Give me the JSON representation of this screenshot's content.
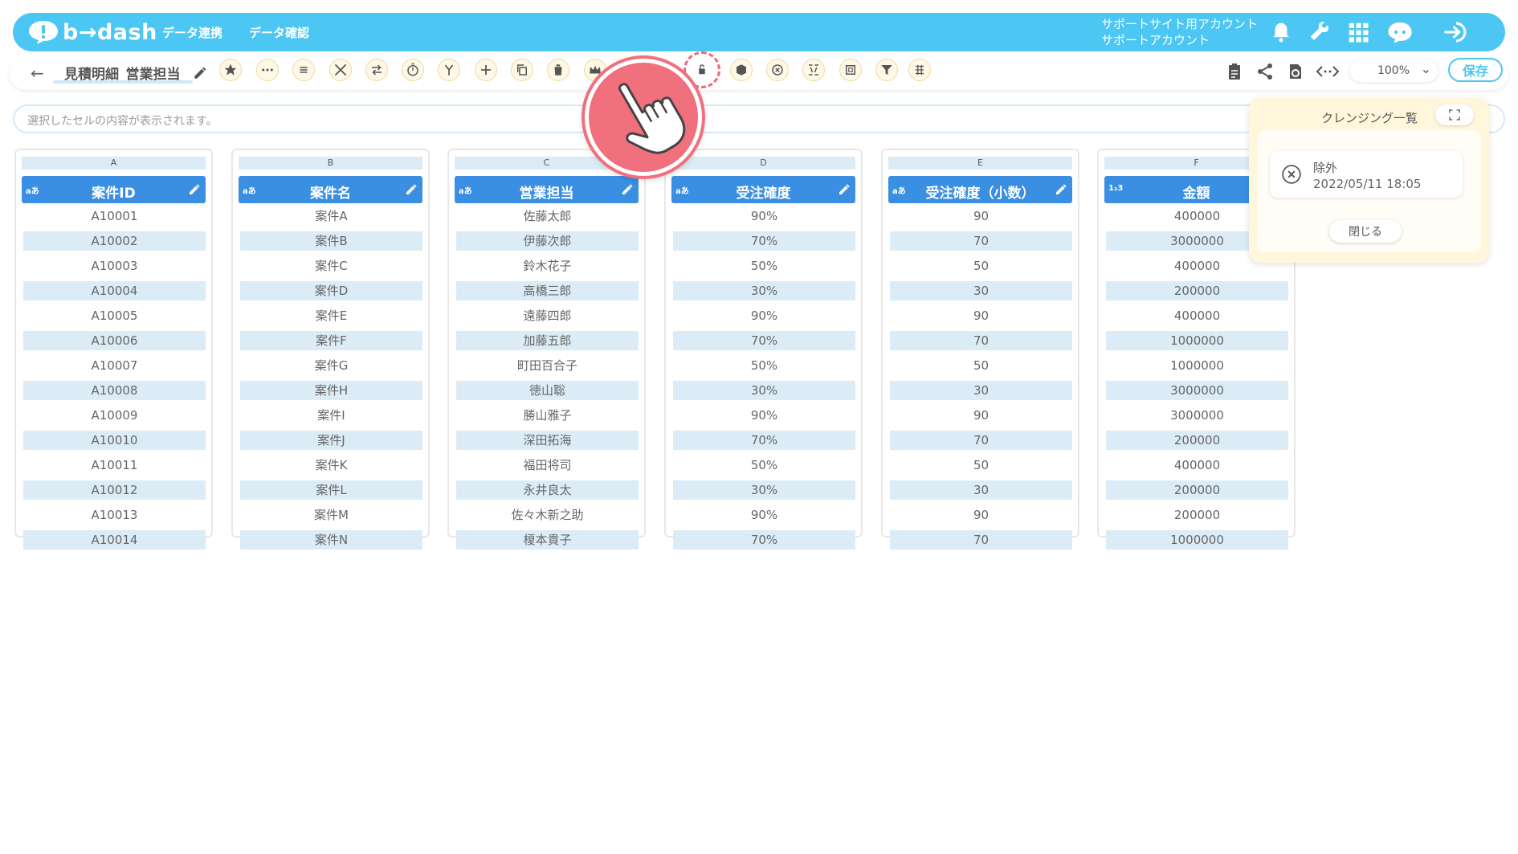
{
  "header": {
    "logo_text": "b→dash",
    "nav": [
      "データ連携",
      "データ確認"
    ],
    "account_line1": "サポートサイト用アカウント",
    "account_line2": "サポートアカウント",
    "icons": [
      "bell-icon",
      "wrench-icon",
      "grid-icon",
      "chat-bot-icon",
      "logout-icon"
    ]
  },
  "toolbar": {
    "back_icon": "←",
    "recipe_name": "見積明細_営業担当",
    "zoom": "100%",
    "save_label": "保存"
  },
  "cellbar": {
    "placeholder": "選択したセルの内容が表示されます。"
  },
  "columns": [
    {
      "letter": "A",
      "type": "aあ",
      "title": "案件ID",
      "values": [
        "A10001",
        "A10002",
        "A10003",
        "A10004",
        "A10005",
        "A10006",
        "A10007",
        "A10008",
        "A10009",
        "A10010",
        "A10011",
        "A10012",
        "A10013",
        "A10014"
      ]
    },
    {
      "letter": "B",
      "type": "aあ",
      "title": "案件名",
      "values": [
        "案件A",
        "案件B",
        "案件C",
        "案件D",
        "案件E",
        "案件F",
        "案件G",
        "案件H",
        "案件I",
        "案件J",
        "案件K",
        "案件L",
        "案件M",
        "案件N"
      ]
    },
    {
      "letter": "C",
      "type": "aあ",
      "title": "営業担当",
      "values": [
        "佐藤太郎",
        "伊藤次郎",
        "鈴木花子",
        "高橋三郎",
        "遠藤四郎",
        "加藤五郎",
        "町田百合子",
        "徳山聡",
        "勝山雅子",
        "深田拓海",
        "福田将司",
        "永井良太",
        "佐々木新之助",
        "榎本貴子"
      ]
    },
    {
      "letter": "D",
      "type": "aあ",
      "title": "受注確度",
      "values": [
        "90%",
        "70%",
        "50%",
        "30%",
        "90%",
        "70%",
        "50%",
        "30%",
        "90%",
        "70%",
        "50%",
        "30%",
        "90%",
        "70%"
      ]
    },
    {
      "letter": "E",
      "type": "aあ",
      "title": "受注確度（小数）",
      "values": [
        "90",
        "70",
        "50",
        "30",
        "90",
        "70",
        "50",
        "30",
        "90",
        "70",
        "50",
        "30",
        "90",
        "70"
      ]
    },
    {
      "letter": "F",
      "type": "1₂3",
      "title": "金額",
      "values": [
        "400000",
        "3000000",
        "400000",
        "200000",
        "400000",
        "1000000",
        "1000000",
        "3000000",
        "3000000",
        "200000",
        "400000",
        "200000",
        "200000",
        "1000000"
      ]
    }
  ],
  "panel": {
    "title": "クレンジング一覧",
    "item_name": "除外",
    "item_date": "2022/05/11 18:05",
    "close_label": "閉じる"
  },
  "colors": {
    "header_blue": "#4cc6f2",
    "column_head_blue": "#3b8fe2",
    "row_alt": "#dcecf7",
    "pointer_red": "#f0707e",
    "panel_bg": "#fff6dc"
  }
}
